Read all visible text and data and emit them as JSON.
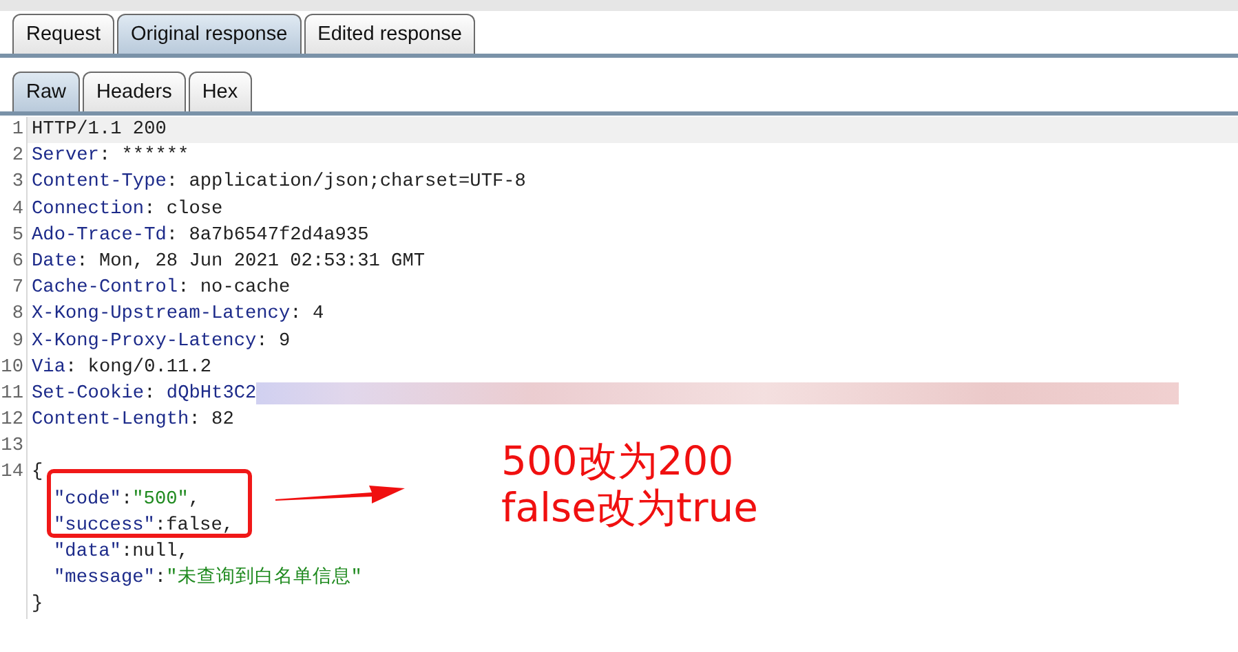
{
  "tabs": [
    {
      "label": "Request",
      "selected": false
    },
    {
      "label": "Original response",
      "selected": true
    },
    {
      "label": "Edited response",
      "selected": false
    }
  ],
  "view_tabs": [
    {
      "label": "Raw",
      "selected": true
    },
    {
      "label": "Headers",
      "selected": false
    },
    {
      "label": "Hex",
      "selected": false
    }
  ],
  "lines": [
    {
      "number": "1",
      "current": true,
      "segments": [
        {
          "kind": "plain",
          "text": "HTTP/1.1 200"
        }
      ]
    },
    {
      "number": "2",
      "segments": [
        {
          "kind": "key",
          "text": "Server"
        },
        {
          "kind": "plain",
          "text": ": ******"
        }
      ]
    },
    {
      "number": "3",
      "segments": [
        {
          "kind": "key",
          "text": "Content-Type"
        },
        {
          "kind": "plain",
          "text": ": application/json;charset=UTF-8"
        }
      ]
    },
    {
      "number": "4",
      "segments": [
        {
          "kind": "key",
          "text": "Connection"
        },
        {
          "kind": "plain",
          "text": ": close"
        }
      ]
    },
    {
      "number": "5",
      "segments": [
        {
          "kind": "key",
          "text": "Ado-Trace-Td"
        },
        {
          "kind": "plain",
          "text": ": 8a7b6547f2d4a935"
        }
      ]
    },
    {
      "number": "6",
      "segments": [
        {
          "kind": "key",
          "text": "Date"
        },
        {
          "kind": "plain",
          "text": ": Mon, 28 Jun 2021 02:53:31 GMT"
        }
      ]
    },
    {
      "number": "7",
      "segments": [
        {
          "kind": "key",
          "text": "Cache-Control"
        },
        {
          "kind": "plain",
          "text": ": no-cache"
        }
      ]
    },
    {
      "number": "8",
      "segments": [
        {
          "kind": "key",
          "text": "X-Kong-Upstream-Latency"
        },
        {
          "kind": "plain",
          "text": ": 4"
        }
      ]
    },
    {
      "number": "9",
      "segments": [
        {
          "kind": "key",
          "text": "X-Kong-Proxy-Latency"
        },
        {
          "kind": "plain",
          "text": ": 9"
        }
      ]
    },
    {
      "number": "10",
      "segments": [
        {
          "kind": "key",
          "text": "Via"
        },
        {
          "kind": "plain",
          "text": ": kong/0.11.2"
        }
      ]
    },
    {
      "number": "11",
      "redacted": true,
      "segments": [
        {
          "kind": "key",
          "text": "Set-Cookie"
        },
        {
          "kind": "plain",
          "text": ": "
        },
        {
          "kind": "key",
          "text": "dQbHt3C2"
        }
      ]
    },
    {
      "number": "12",
      "segments": [
        {
          "kind": "key",
          "text": "Content-Length"
        },
        {
          "kind": "plain",
          "text": ": 82"
        }
      ]
    },
    {
      "number": "13"
    },
    {
      "number": "14",
      "segments": [
        {
          "kind": "plain",
          "text": "{"
        }
      ]
    },
    {
      "indented": true,
      "segments": [
        {
          "kind": "key",
          "text": "\"code\""
        },
        {
          "kind": "plain",
          "text": ":"
        },
        {
          "kind": "string",
          "text": "\"500\""
        },
        {
          "kind": "plain",
          "text": ","
        }
      ]
    },
    {
      "indented": true,
      "segments": [
        {
          "kind": "key",
          "text": "\"success\""
        },
        {
          "kind": "plain",
          "text": ":false,"
        }
      ]
    },
    {
      "indented": true,
      "segments": [
        {
          "kind": "key",
          "text": "\"data\""
        },
        {
          "kind": "plain",
          "text": ":null,"
        }
      ]
    },
    {
      "indented": true,
      "segments": [
        {
          "kind": "key",
          "text": "\"message\""
        },
        {
          "kind": "plain",
          "text": ":"
        },
        {
          "kind": "string",
          "text": "\"未查询到白名单信息\""
        }
      ]
    },
    {
      "segments": [
        {
          "kind": "plain",
          "text": "}"
        }
      ]
    }
  ],
  "annotation": {
    "lines": [
      "500改为200",
      "false改为true"
    ]
  }
}
